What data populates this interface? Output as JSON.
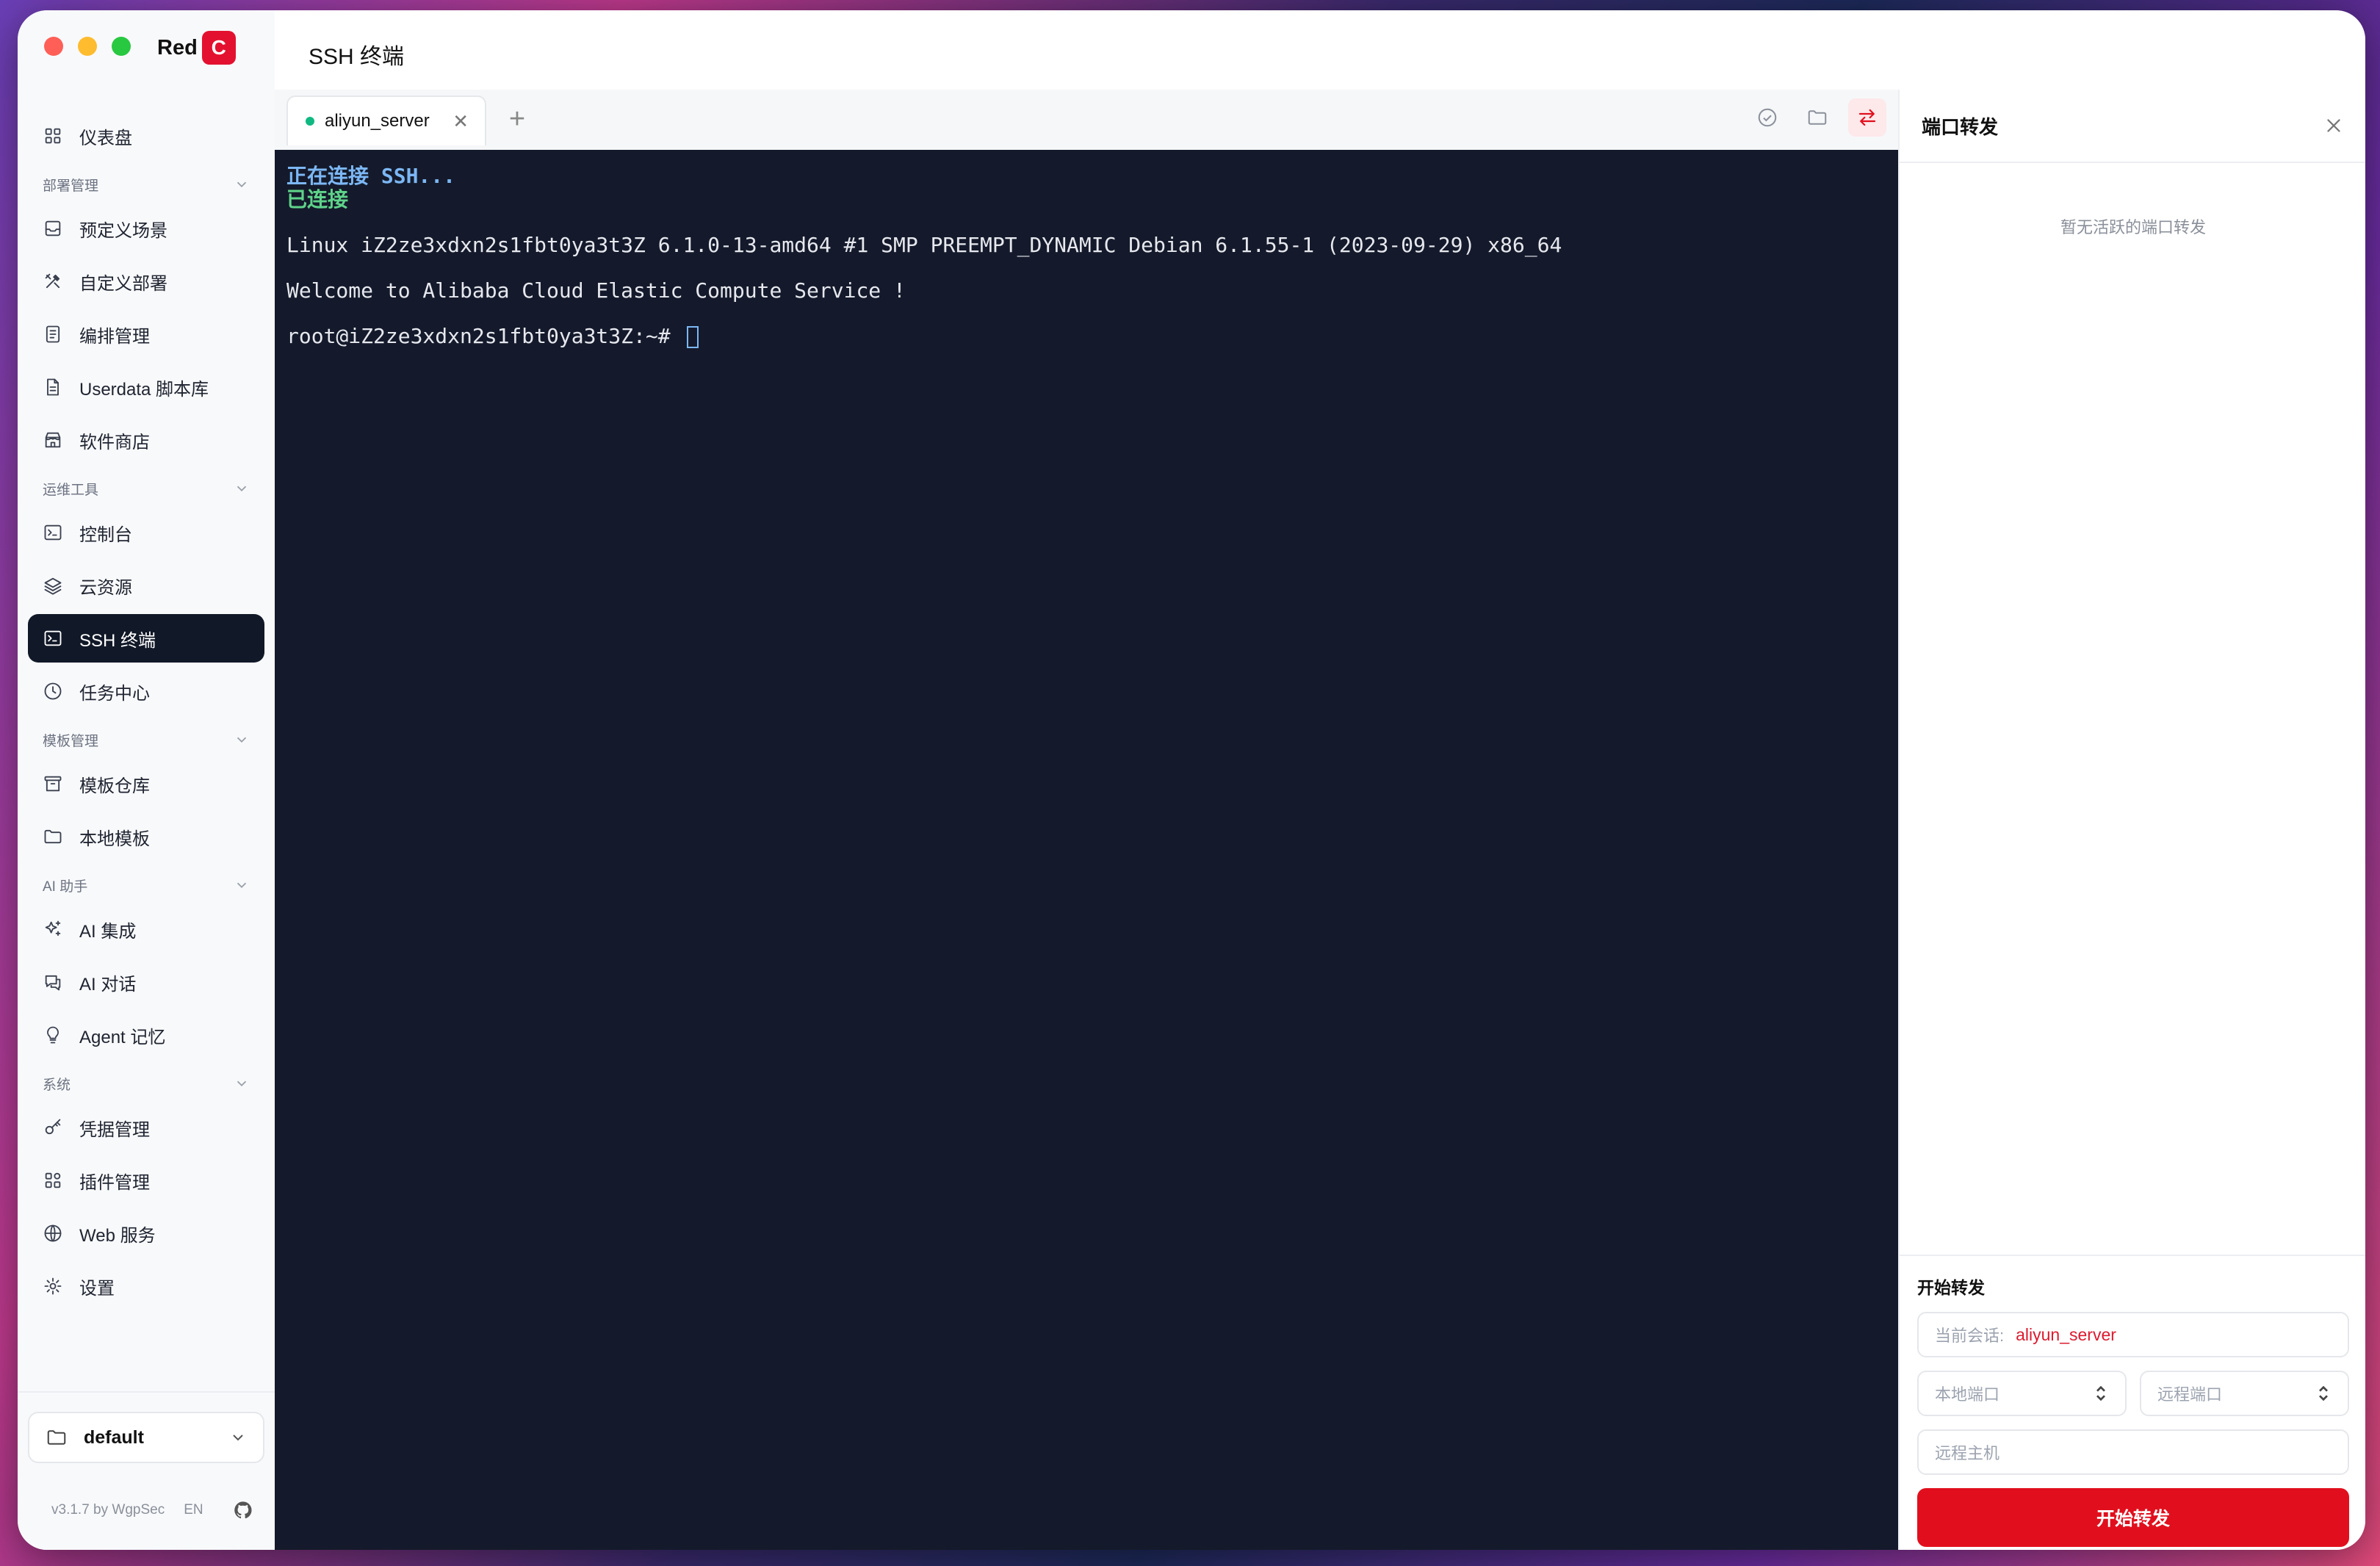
{
  "brand": {
    "name": "Red",
    "badge": "C"
  },
  "header": {
    "title": "SSH 终端"
  },
  "sidebar": {
    "items": [
      {
        "type": "item",
        "label": "仪表盘",
        "icon": "dashboard-icon"
      },
      {
        "type": "group",
        "label": "部署管理"
      },
      {
        "type": "item",
        "label": "预定义场景",
        "icon": "inbox-icon"
      },
      {
        "type": "item",
        "label": "自定义部署",
        "icon": "tools-icon"
      },
      {
        "type": "item",
        "label": "编排管理",
        "icon": "document-icon"
      },
      {
        "type": "item",
        "label": "Userdata 脚本库",
        "icon": "file-icon"
      },
      {
        "type": "item",
        "label": "软件商店",
        "icon": "store-icon"
      },
      {
        "type": "group",
        "label": "运维工具"
      },
      {
        "type": "item",
        "label": "控制台",
        "icon": "terminal-icon"
      },
      {
        "type": "item",
        "label": "云资源",
        "icon": "layers-icon"
      },
      {
        "type": "item",
        "label": "SSH 终端",
        "icon": "terminal-icon",
        "active": true
      },
      {
        "type": "item",
        "label": "任务中心",
        "icon": "clock-icon"
      },
      {
        "type": "group",
        "label": "模板管理"
      },
      {
        "type": "item",
        "label": "模板仓库",
        "icon": "archive-icon"
      },
      {
        "type": "item",
        "label": "本地模板",
        "icon": "folder-icon"
      },
      {
        "type": "group",
        "label": "AI 助手"
      },
      {
        "type": "item",
        "label": "AI 集成",
        "icon": "sparkles-icon"
      },
      {
        "type": "item",
        "label": "AI 对话",
        "icon": "chat-icon"
      },
      {
        "type": "item",
        "label": "Agent 记忆",
        "icon": "bulb-icon"
      },
      {
        "type": "group",
        "label": "系统"
      },
      {
        "type": "item",
        "label": "凭据管理",
        "icon": "key-icon"
      },
      {
        "type": "item",
        "label": "插件管理",
        "icon": "plugin-icon"
      },
      {
        "type": "item",
        "label": "Web 服务",
        "icon": "globe-icon"
      },
      {
        "type": "item",
        "label": "设置",
        "icon": "gear-icon"
      }
    ],
    "workspace": "default",
    "version": "v3.1.7 by WgpSec",
    "lang": "EN"
  },
  "tabs": [
    {
      "label": "aliyun_server",
      "status_color": "#10b981"
    }
  ],
  "terminal": {
    "lines": [
      {
        "text": "正在连接 SSH...",
        "style": "blue"
      },
      {
        "text": "已连接",
        "style": "green"
      },
      {
        "text": "",
        "style": "plain"
      },
      {
        "text": "Linux iZ2ze3xdxn2s1fbt0ya3t3Z 6.1.0-13-amd64 #1 SMP PREEMPT_DYNAMIC Debian 6.1.55-1 (2023-09-29) x86_64",
        "style": "plain"
      },
      {
        "text": "",
        "style": "plain"
      },
      {
        "text": "Welcome to Alibaba Cloud Elastic Compute Service !",
        "style": "plain"
      },
      {
        "text": "",
        "style": "plain"
      },
      {
        "text": "root@iZ2ze3xdxn2s1fbt0ya3t3Z:~# ",
        "style": "prompt"
      }
    ]
  },
  "panel": {
    "title": "端口转发",
    "empty": "暂无活跃的端口转发",
    "section_title": "开始转发",
    "session_label": "当前会话:",
    "session_value": "aliyun_server",
    "local_port_placeholder": "本地端口",
    "remote_port_placeholder": "远程端口",
    "remote_host_placeholder": "远程主机",
    "start_button": "开始转发"
  },
  "colors": {
    "accent": "#e10f1d",
    "terminal_bg": "#141a2b",
    "active_nav": "#111827"
  }
}
